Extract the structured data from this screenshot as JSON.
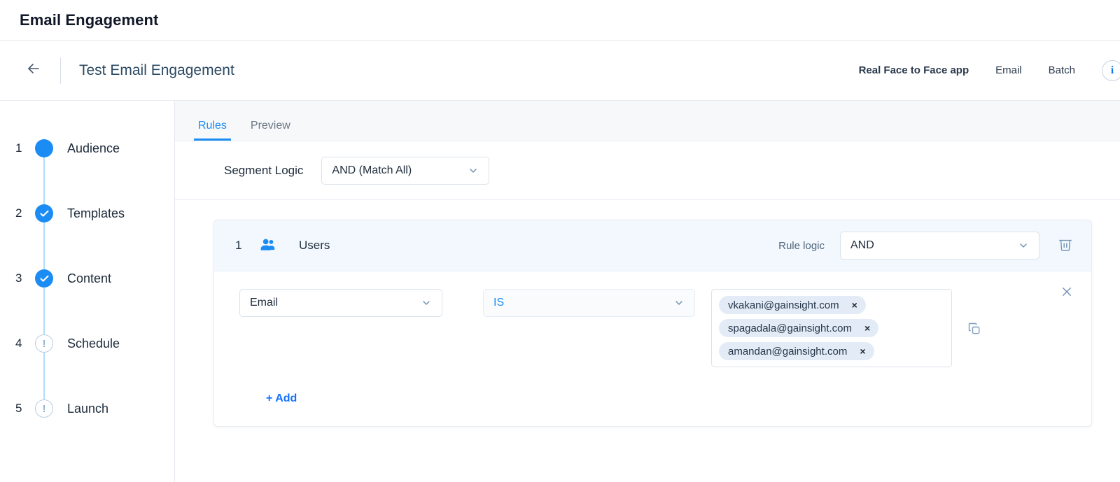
{
  "app": {
    "title": "Email Engagement"
  },
  "subheader": {
    "back_icon": "arrow-left-icon",
    "page_name": "Test Email Engagement",
    "meta": [
      {
        "label": "Real Face to Face app",
        "bold": true
      },
      {
        "label": "Email",
        "bold": false
      },
      {
        "label": "Batch",
        "bold": false
      }
    ],
    "info_icon_label": "i"
  },
  "stepper": {
    "steps": [
      {
        "num": "1",
        "label": "Audience",
        "state": "active"
      },
      {
        "num": "2",
        "label": "Templates",
        "state": "done"
      },
      {
        "num": "3",
        "label": "Content",
        "state": "done"
      },
      {
        "num": "4",
        "label": "Schedule",
        "state": "pending",
        "mark": "!"
      },
      {
        "num": "5",
        "label": "Launch",
        "state": "pending",
        "mark": "!"
      }
    ]
  },
  "tabs": [
    {
      "label": "Rules",
      "active": true
    },
    {
      "label": "Preview",
      "active": false
    }
  ],
  "segment": {
    "label": "Segment Logic",
    "value": "AND (Match All)"
  },
  "rule": {
    "index": "1",
    "icon": "users-icon",
    "title": "Users",
    "logic_label": "Rule logic",
    "logic_value": "AND",
    "delete_icon": "trash-icon",
    "close_icon": "close-icon",
    "copy_icon": "copy-icon",
    "condition": {
      "field": "Email",
      "operator": "IS",
      "values": [
        "vkakani@gainsight.com",
        "spagadala@gainsight.com",
        "amandan@gainsight.com"
      ],
      "remove_label": "×"
    },
    "add_label": "+ Add"
  },
  "colors": {
    "accent": "#1b8cf3",
    "link": "#1472ff",
    "card_header_bg": "#f2f8fd",
    "chip_bg": "#e3ecf6",
    "tabbar_bg": "#f7f8fa",
    "text_dark": "#1d2b3a",
    "pending_outline": "#b9cfe3"
  }
}
